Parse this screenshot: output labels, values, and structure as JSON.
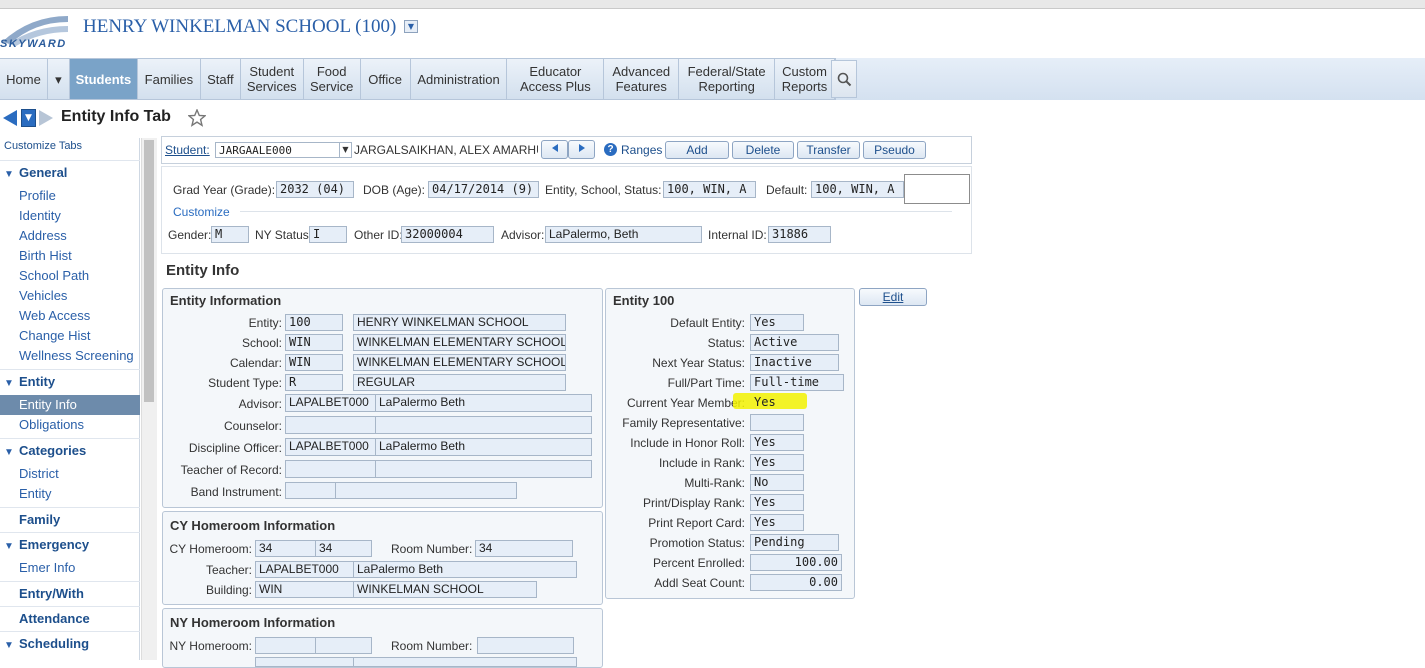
{
  "header": {
    "logo_text": "SKYWARD",
    "school_title": "HENRY WINKELMAN SCHOOL (100)",
    "school_dropdown_icon": "chevron-down-icon"
  },
  "nav": {
    "items": [
      {
        "label": "Home",
        "w": 48
      },
      {
        "label": "▾",
        "w": 22
      },
      {
        "label": "Students",
        "w": 68,
        "active": true
      },
      {
        "label": "Families",
        "w": 63
      },
      {
        "label": "Staff",
        "w": 40
      },
      {
        "label": "Student Services",
        "w": 63
      },
      {
        "label": "Food Service",
        "w": 57
      },
      {
        "label": "Office",
        "w": 50
      },
      {
        "label": "Administration",
        "w": 97
      },
      {
        "label": "Educator Access Plus",
        "w": 97
      },
      {
        "label": "Advanced Features",
        "w": 75
      },
      {
        "label": "Federal/State Reporting",
        "w": 96
      },
      {
        "label": "Custom Reports",
        "w": 60
      }
    ],
    "search_icon": "search-icon"
  },
  "page": {
    "title": "Entity Info Tab",
    "favorite_icon": "star-icon"
  },
  "sidebar": {
    "customize": "Customize Tabs",
    "general": "General",
    "general_items": [
      "Profile",
      "Identity",
      "Address",
      "Birth Hist",
      "School Path",
      "Vehicles",
      "Web Access",
      "Change Hist",
      "Wellness Screening"
    ],
    "entity": "Entity",
    "entity_items": [
      "Entity Info",
      "Obligations"
    ],
    "categories": "Categories",
    "categories_items": [
      "District",
      "Entity"
    ],
    "family": "Family",
    "emergency": "Emergency",
    "emergency_items": [
      "Emer Info"
    ],
    "entry_with": "Entry/With",
    "attendance": "Attendance",
    "scheduling": "Scheduling"
  },
  "studentbar": {
    "student_label": "Student:",
    "student_id": "JARGAALE000",
    "student_name": "JARGALSAIKHAN, ALEX AMARHUU",
    "ranges": "Ranges",
    "add": "Add",
    "delete": "Delete",
    "transfer": "Transfer",
    "pseudo": "Pseudo"
  },
  "info": {
    "grad_year_label": "Grad Year (Grade):",
    "grad_year": "2032 (04)",
    "dob_label": "DOB (Age):",
    "dob": "04/17/2014 (9)",
    "ess_label": "Entity, School, Status:",
    "ess": "100, WIN, A",
    "default_label": "Default:",
    "default": "100, WIN, A",
    "customize": "Customize",
    "gender_label": "Gender:",
    "gender": "M",
    "nystatus_label": "NY Status:",
    "nystatus": "I",
    "otherid_label": "Other ID:",
    "otherid": "32000004",
    "advisor_label": "Advisor:",
    "advisor": "LaPalermo, Beth",
    "internalid_label": "Internal ID:",
    "internalid": "31886"
  },
  "entity_info": {
    "section_title": "Entity Info",
    "edit": "Edit",
    "panel_title": "Entity Information",
    "entity_label": "Entity:",
    "entity_code": "100",
    "entity_name": "HENRY WINKELMAN SCHOOL",
    "school_label": "School:",
    "school_code": "WIN",
    "school_name": "WINKELMAN ELEMENTARY SCHOOL",
    "calendar_label": "Calendar:",
    "calendar_code": "WIN",
    "calendar_name": "WINKELMAN ELEMENTARY SCHOOL",
    "student_type_label": "Student Type:",
    "student_type_code": "R",
    "student_type_name": "REGULAR",
    "advisor_label": "Advisor:",
    "advisor_code": "LAPALBET000",
    "advisor_name": "LaPalermo Beth",
    "counselor_label": "Counselor:",
    "counselor_code": "",
    "counselor_name": "",
    "discipline_label": "Discipline Officer:",
    "discipline_code": "LAPALBET000",
    "discipline_name": "LaPalermo Beth",
    "tor_label": "Teacher of Record:",
    "tor_code": "",
    "tor_name": "",
    "band_label": "Band Instrument:",
    "band_code": "",
    "band_name": ""
  },
  "cy_homeroom": {
    "title": "CY Homeroom Information",
    "homeroom_label": "CY Homeroom:",
    "homeroom1": "34",
    "homeroom2": "34",
    "room_label": "Room Number:",
    "room": "34",
    "teacher_label": "Teacher:",
    "teacher_code": "LAPALBET000",
    "teacher_name": "LaPalermo Beth",
    "building_label": "Building:",
    "building_code": "WIN",
    "building_name": "WINKELMAN SCHOOL"
  },
  "ny_homeroom": {
    "title": "NY Homeroom Information",
    "homeroom_label": "NY Homeroom:",
    "room_label": "Room Number:"
  },
  "entity100": {
    "title": "Entity 100",
    "rows": [
      {
        "label": "Default Entity:",
        "value": "Yes",
        "w": 54
      },
      {
        "label": "Status:",
        "value": "Active",
        "w": 89
      },
      {
        "label": "Next Year Status:",
        "value": "Inactive",
        "w": 89
      },
      {
        "label": "Full/Part Time:",
        "value": "Full-time",
        "w": 94
      },
      {
        "label": "Current Year Member:",
        "value": "Yes",
        "w": 54
      },
      {
        "label": "Family Representative:",
        "value": "",
        "w": 54
      },
      {
        "label": "Include in Honor Roll:",
        "value": "Yes",
        "w": 54
      },
      {
        "label": "Include in Rank:",
        "value": "Yes",
        "w": 54
      },
      {
        "label": "Multi-Rank:",
        "value": "No",
        "w": 54
      },
      {
        "label": "Print/Display Rank:",
        "value": "Yes",
        "w": 54
      },
      {
        "label": "Print Report Card:",
        "value": "Yes",
        "w": 54
      },
      {
        "label": "Promotion Status:",
        "value": "Pending",
        "w": 89
      },
      {
        "label": "Percent Enrolled:",
        "value": "100.00",
        "w": 92,
        "right": true
      },
      {
        "label": "Addl Seat Count:",
        "value": "0.00",
        "w": 92,
        "right": true
      }
    ],
    "highlight_color": "#f2f200"
  }
}
